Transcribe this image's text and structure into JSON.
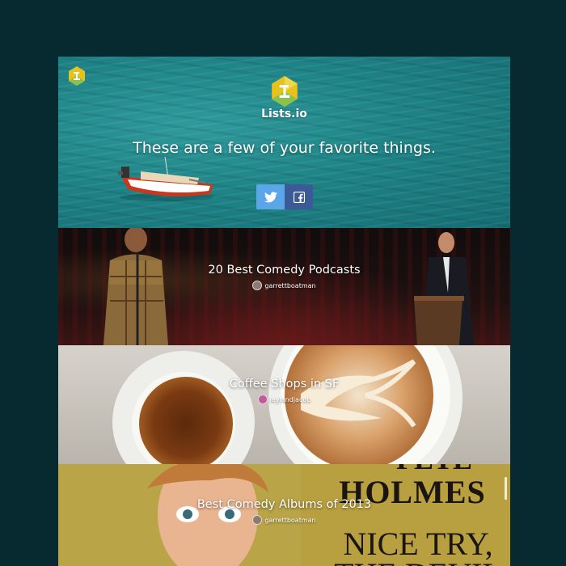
{
  "brand": {
    "name": "Lists.io"
  },
  "hero": {
    "tagline": "These are a few of your favorite things.",
    "share": [
      {
        "service": "Twitter",
        "icon": "twitter-icon",
        "color": "#5aa6e8"
      },
      {
        "service": "Facebook",
        "icon": "facebook-icon",
        "color": "#3d5a98"
      }
    ]
  },
  "lists": [
    {
      "title": "20 Best Comedy Podcasts",
      "author": "garrettboatman"
    },
    {
      "title": "Coffee Shops in SF",
      "author": "leylandjacob"
    },
    {
      "title": "Best Comedy Albums of 2013",
      "author": "garrettboatman"
    }
  ],
  "album_art": {
    "line1": "PETE",
    "line2": "HOLMES",
    "line3": "NICE TRY,",
    "line4": "THE DEVIL"
  },
  "colors": {
    "page_background": "#062a30",
    "logo_yellow": "#e8c21c",
    "logo_green": "#8bc34a"
  }
}
